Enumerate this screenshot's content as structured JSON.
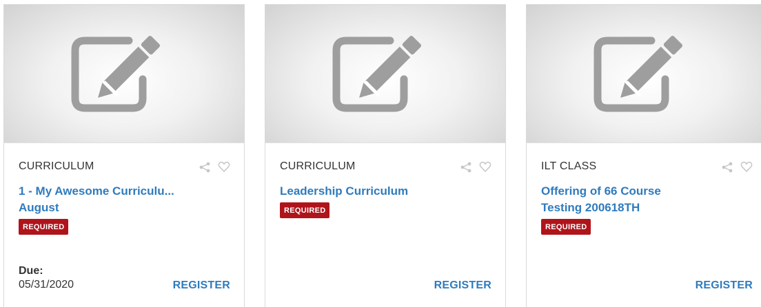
{
  "cards": [
    {
      "type": "CURRICULUM",
      "title_line1": "1 - My Awesome Curriculu...",
      "title_line2": "August",
      "badge": "REQUIRED",
      "due_label": "Due:",
      "due_date": "05/31/2020",
      "register_label": "REGISTER",
      "thumbnail_icon": "edit-pencil-icon",
      "share_icon": "share-icon",
      "favorite_icon": "heart-icon"
    },
    {
      "type": "CURRICULUM",
      "title_line1": "Leadership Curriculum",
      "title_line2": "",
      "badge": "REQUIRED",
      "register_label": "REGISTER",
      "thumbnail_icon": "edit-pencil-icon",
      "share_icon": "share-icon",
      "favorite_icon": "heart-icon"
    },
    {
      "type": "ILT CLASS",
      "title_line1": "Offering of 66 Course",
      "title_line2": "Testing 200618TH",
      "badge": "REQUIRED",
      "register_label": "REGISTER",
      "thumbnail_icon": "edit-pencil-icon",
      "share_icon": "share-icon",
      "favorite_icon": "heart-icon"
    }
  ],
  "colors": {
    "link": "#2f7bbd",
    "badge_bg": "#b0141b",
    "icon_gray": "#9e9e9e"
  }
}
